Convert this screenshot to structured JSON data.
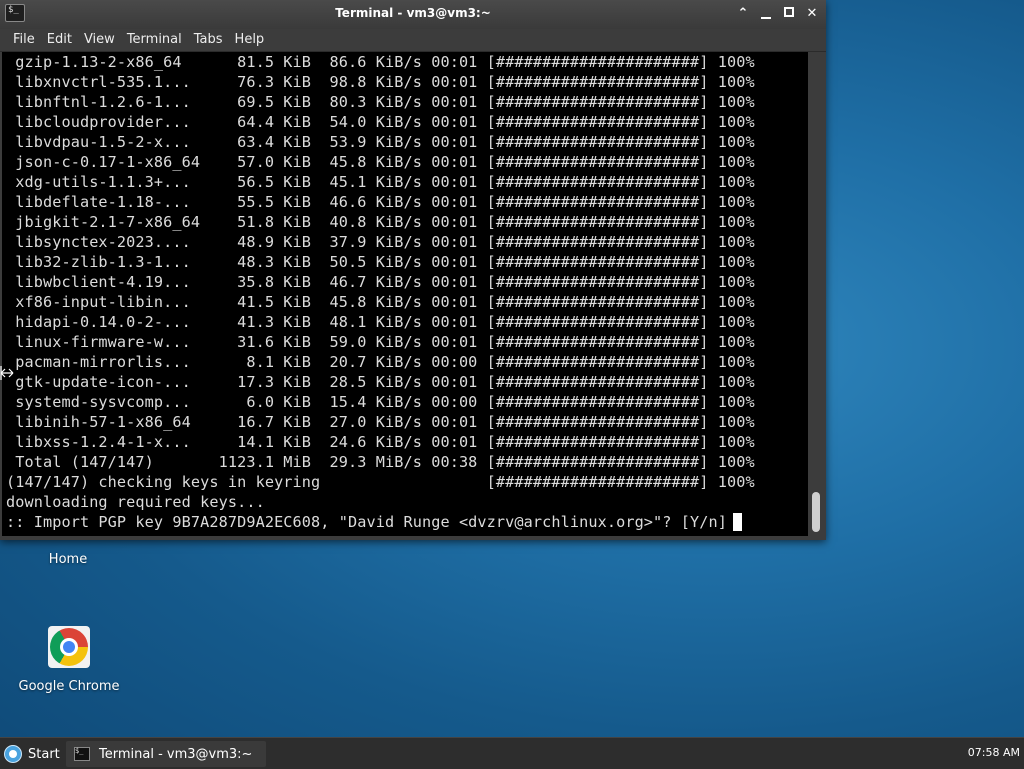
{
  "window": {
    "title": "Terminal - vm3@vm3:~",
    "app_icon_text": "$_"
  },
  "menu": [
    "File",
    "Edit",
    "View",
    "Terminal",
    "Tabs",
    "Help"
  ],
  "terminal_lines": [
    " gzip-1.13-2-x86_64      81.5 KiB  86.6 KiB/s 00:01 [######################] 100%",
    " libxnvctrl-535.1...     76.3 KiB  98.8 KiB/s 00:01 [######################] 100%",
    " libnftnl-1.2.6-1...     69.5 KiB  80.3 KiB/s 00:01 [######################] 100%",
    " libcloudprovider...     64.4 KiB  54.0 KiB/s 00:01 [######################] 100%",
    " libvdpau-1.5-2-x...     63.4 KiB  53.9 KiB/s 00:01 [######################] 100%",
    " json-c-0.17-1-x86_64    57.0 KiB  45.8 KiB/s 00:01 [######################] 100%",
    " xdg-utils-1.1.3+...     56.5 KiB  45.1 KiB/s 00:01 [######################] 100%",
    " libdeflate-1.18-...     55.5 KiB  46.6 KiB/s 00:01 [######################] 100%",
    " jbigkit-2.1-7-x86_64    51.8 KiB  40.8 KiB/s 00:01 [######################] 100%",
    " libsynctex-2023....     48.9 KiB  37.9 KiB/s 00:01 [######################] 100%",
    " lib32-zlib-1.3-1...     48.3 KiB  50.5 KiB/s 00:01 [######################] 100%",
    " libwbclient-4.19...     35.8 KiB  46.7 KiB/s 00:01 [######################] 100%",
    " xf86-input-libin...     41.5 KiB  45.8 KiB/s 00:01 [######################] 100%",
    " hidapi-0.14.0-2-...     41.3 KiB  48.1 KiB/s 00:01 [######################] 100%",
    " linux-firmware-w...     31.6 KiB  59.0 KiB/s 00:01 [######################] 100%",
    " pacman-mirrorlis...      8.1 KiB  20.7 KiB/s 00:00 [######################] 100%",
    " gtk-update-icon-...     17.3 KiB  28.5 KiB/s 00:01 [######################] 100%",
    " systemd-sysvcomp...      6.0 KiB  15.4 KiB/s 00:00 [######################] 100%",
    " libinih-57-1-x86_64     16.7 KiB  27.0 KiB/s 00:01 [######################] 100%",
    " libxss-1.2.4-1-x...     14.1 KiB  24.6 KiB/s 00:01 [######################] 100%",
    " Total (147/147)       1123.1 MiB  29.3 MiB/s 00:38 [######################] 100%",
    "(147/147) checking keys in keyring                  [######################] 100%",
    "downloading required keys...",
    ":: Import PGP key 9B7A287D9A2EC608, \"David Runge <dvzrv@archlinux.org>\"? [Y/n]"
  ],
  "desktop": {
    "home_label": "Home",
    "chrome_label": "Google Chrome"
  },
  "taskbar": {
    "start_label": "Start",
    "task_label": "Terminal - vm3@vm3:~",
    "task_icon_text": "$_",
    "clock": "07:58 AM"
  },
  "colors": {
    "terminal_bg": "#000000",
    "terminal_fg": "#dcdcdc",
    "desktop_blue": "#1f6fa6",
    "chrome_bar": "#3c3c3c"
  }
}
